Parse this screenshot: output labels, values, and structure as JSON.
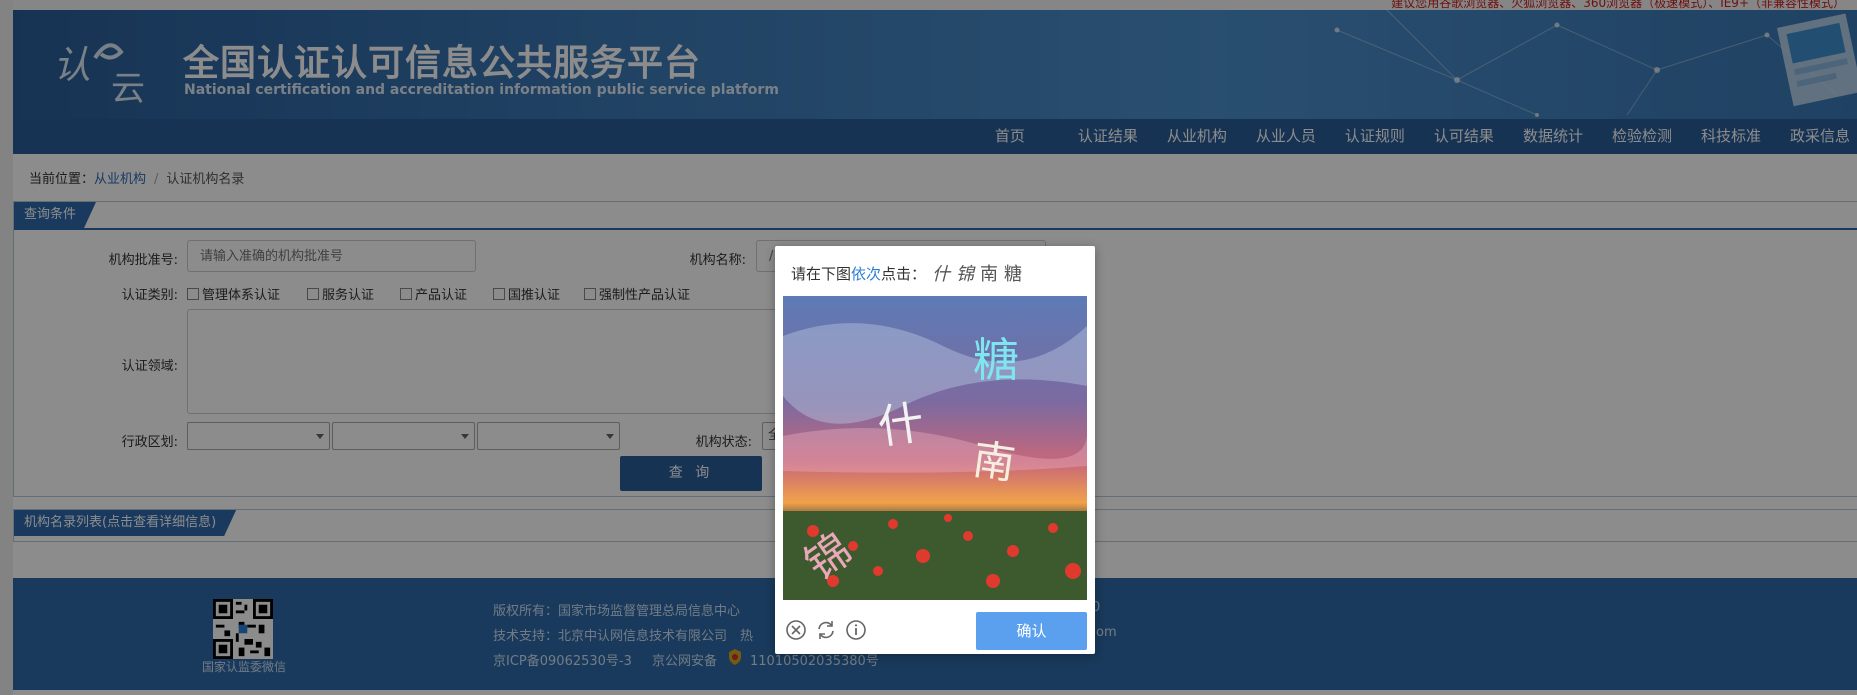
{
  "top_notice": "建议您用谷歌浏览器、火狐浏览器、360浏览器（极速模式）、IE9+（非兼容性模式）",
  "header": {
    "logo_text": "认云",
    "title_cn": "全国认证认可信息公共服务平台",
    "title_en": "National certification and accreditation information public service platform"
  },
  "nav": [
    "首页",
    "认证结果",
    "从业机构",
    "从业人员",
    "认证规则",
    "认可结果",
    "数据统计",
    "检验检测",
    "科技标准",
    "政采信息"
  ],
  "breadcrumb": {
    "prefix": "当前位置：",
    "link": "从业机构",
    "sep": "/",
    "current": "认证机构名录"
  },
  "query": {
    "tab_label": "查询条件",
    "approval_no_label": "机构批准号:",
    "approval_no_placeholder": "请输入准确的机构批准号",
    "org_name_label": "机构名称:",
    "org_name_placeholder": "/",
    "cert_type_label": "认证类别:",
    "cert_types": [
      "管理体系认证",
      "服务认证",
      "产品认证",
      "国推认证",
      "强制性产品认证"
    ],
    "cert_field_label": "认证领域:",
    "region_label": "行政区划:",
    "status_label": "机构状态:",
    "status_value": "全",
    "search_button": "查 询"
  },
  "list": {
    "tab_label": "机构名录列表(点击查看详细信息)"
  },
  "footer": {
    "qr_label": "国家认监委微信",
    "copyright": "版权所有：国家市场监督管理总局信息中心",
    "copyright_tail": "0",
    "support": "技术支持：北京中认网信息技术有限公司　热",
    "support_tail": "om",
    "icp": "京ICP备09062530号-3",
    "police": "京公网安备",
    "police_no": "11010502035380号"
  },
  "captcha": {
    "instr_prefix": "请在下图",
    "instr_highlight": "依次",
    "instr_suffix": "点击：",
    "chars": [
      "什",
      "锦",
      "南",
      "糖"
    ],
    "image_chars": [
      "糖",
      "什",
      "南",
      "锦"
    ],
    "confirm_button": "确认",
    "icons": [
      "close-icon",
      "refresh-icon",
      "info-icon"
    ]
  }
}
